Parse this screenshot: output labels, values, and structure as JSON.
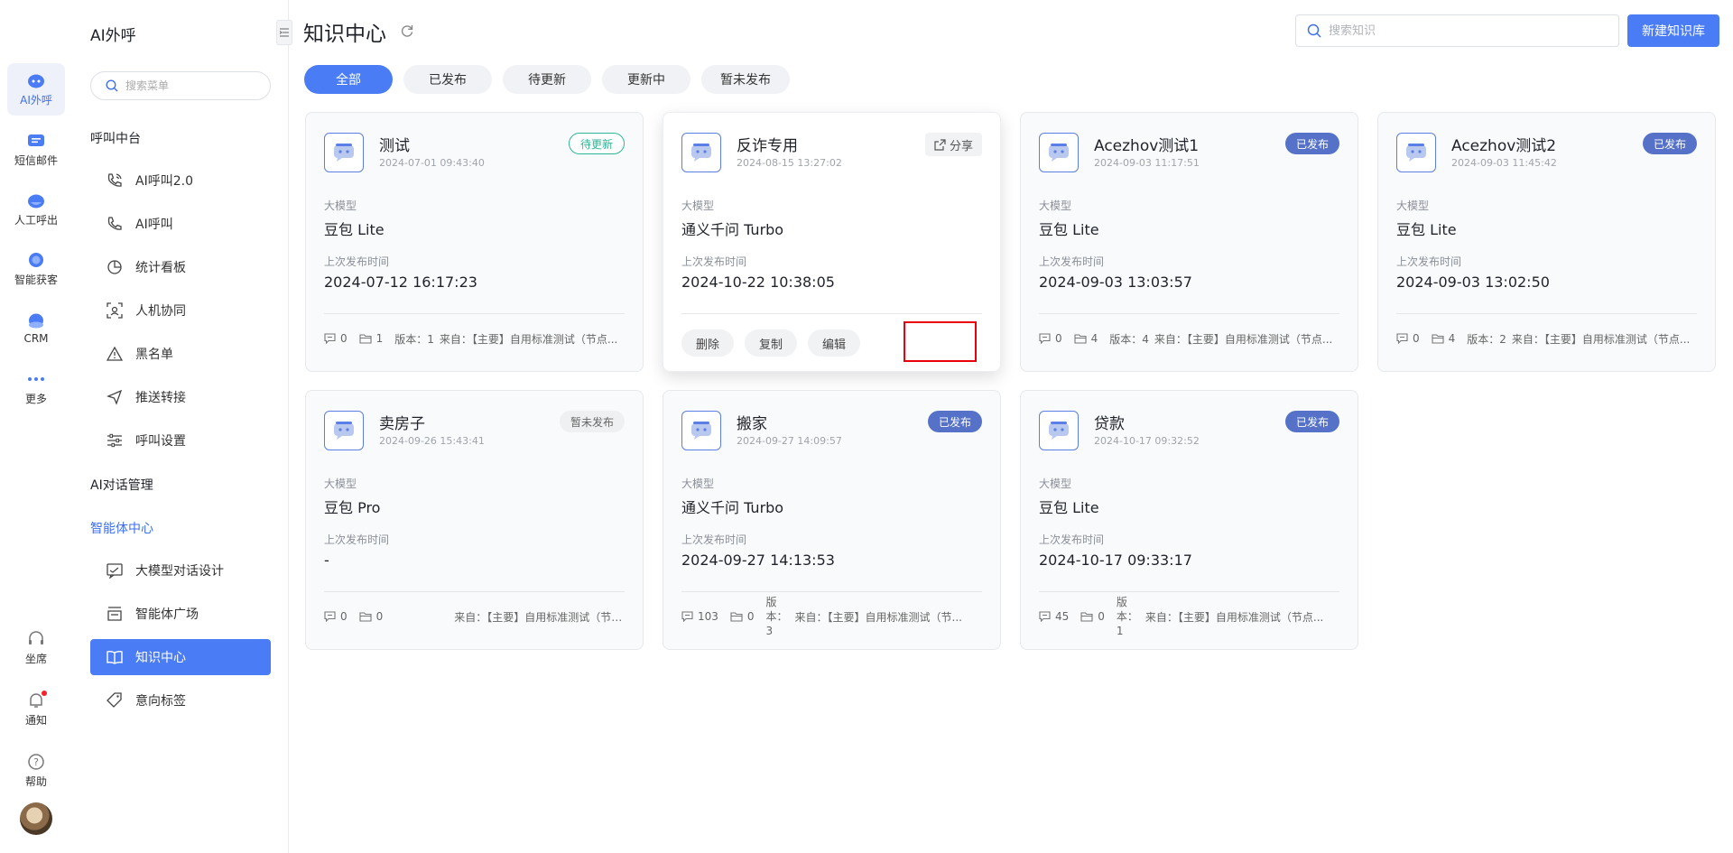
{
  "rail": {
    "items": [
      {
        "label": "AI外呼",
        "icon": "robot-icon",
        "active": true
      },
      {
        "label": "短信邮件",
        "icon": "message-icon",
        "active": false
      },
      {
        "label": "人工呼出",
        "icon": "agent-icon",
        "active": false
      },
      {
        "label": "智能获客",
        "icon": "target-icon",
        "active": false
      },
      {
        "label": "CRM",
        "icon": "crm-icon",
        "active": false
      },
      {
        "label": "更多",
        "icon": "more-icon",
        "active": false
      }
    ],
    "bottom": [
      {
        "label": "坐席",
        "icon": "headset-icon"
      },
      {
        "label": "通知",
        "icon": "bell-icon"
      },
      {
        "label": "帮助",
        "icon": "help-icon"
      }
    ]
  },
  "menu": {
    "title": "AI外呼",
    "search_placeholder": "搜索菜单",
    "group1": "呼叫中台",
    "items1": [
      {
        "label": "AI呼叫2.0",
        "icon": "phone-call-icon"
      },
      {
        "label": "AI呼叫",
        "icon": "phone-icon"
      },
      {
        "label": "统计看板",
        "icon": "pie-chart-icon"
      },
      {
        "label": "人机协同",
        "icon": "face-scan-icon"
      },
      {
        "label": "黑名单",
        "icon": "warning-icon"
      },
      {
        "label": "推送转接",
        "icon": "send-icon"
      },
      {
        "label": "呼叫设置",
        "icon": "sliders-icon"
      }
    ],
    "group2": "AI对话管理",
    "group3": "智能体中心",
    "items3": [
      {
        "label": "大模型对话设计",
        "icon": "chat-design-icon"
      },
      {
        "label": "智能体广场",
        "icon": "store-icon"
      },
      {
        "label": "知识中心",
        "icon": "book-icon",
        "active": true
      },
      {
        "label": "意向标签",
        "icon": "tag-icon"
      }
    ]
  },
  "header": {
    "title": "知识中心",
    "search_placeholder": "搜索知识",
    "new_button": "新建知识库"
  },
  "filters": [
    "全部",
    "已发布",
    "待更新",
    "更新中",
    "暂未发布"
  ],
  "labels": {
    "model": "大模型",
    "last_publish": "上次发布时间",
    "share": "分享",
    "delete": "删除",
    "copy": "复制",
    "edit": "编辑"
  },
  "cards": [
    {
      "name": "测试",
      "date": "2024-07-01 09:43:40",
      "status": "待更新",
      "model": "豆包 Lite",
      "publish_time": "2024-07-12 16:17:23",
      "comments": "0",
      "folders": "1",
      "version": "版本：1",
      "source": "来自：【主要】自用标准测试（节点..."
    },
    {
      "name": "反诈专用",
      "date": "2024-08-15 13:27:02",
      "status": "",
      "model": "通义千问 Turbo",
      "publish_time": "2024-10-22 10:38:05",
      "comments": "",
      "folders": "",
      "version": "",
      "source": ""
    },
    {
      "name": "Acezhov测试1",
      "date": "2024-09-03 11:17:51",
      "status": "已发布",
      "model": "豆包 Lite",
      "publish_time": "2024-09-03 13:03:57",
      "comments": "0",
      "folders": "4",
      "version": "版本：4",
      "source": "来自：【主要】自用标准测试（节点..."
    },
    {
      "name": "Acezhov测试2",
      "date": "2024-09-03 11:45:42",
      "status": "已发布",
      "model": "豆包 Lite",
      "publish_time": "2024-09-03 13:02:50",
      "comments": "0",
      "folders": "4",
      "version": "版本：2",
      "source": "来自：【主要】自用标准测试（节点..."
    },
    {
      "name": "卖房子",
      "date": "2024-09-26 15:43:41",
      "status": "暂未发布",
      "model": "豆包 Pro",
      "publish_time": "-",
      "comments": "0",
      "folders": "0",
      "version": "",
      "source": "来自：【主要】自用标准测试（节点..."
    },
    {
      "name": "搬家",
      "date": "2024-09-27 14:09:57",
      "status": "已发布",
      "model": "通义千问 Turbo",
      "publish_time": "2024-09-27 14:13:53",
      "comments": "103",
      "folders": "0",
      "version": "版本：3",
      "source": "来自：【主要】自用标准测试（节..."
    },
    {
      "name": "贷款",
      "date": "2024-10-17 09:32:52",
      "status": "已发布",
      "model": "豆包 Lite",
      "publish_time": "2024-10-17 09:33:17",
      "comments": "45",
      "folders": "0",
      "version": "版本：1",
      "source": "来自：【主要】自用标准测试（节点..."
    }
  ],
  "colors": {
    "accent": "#4a7cf6",
    "published": "#5572c8",
    "pending": "#2eb497",
    "highlight": "#e8000b"
  }
}
